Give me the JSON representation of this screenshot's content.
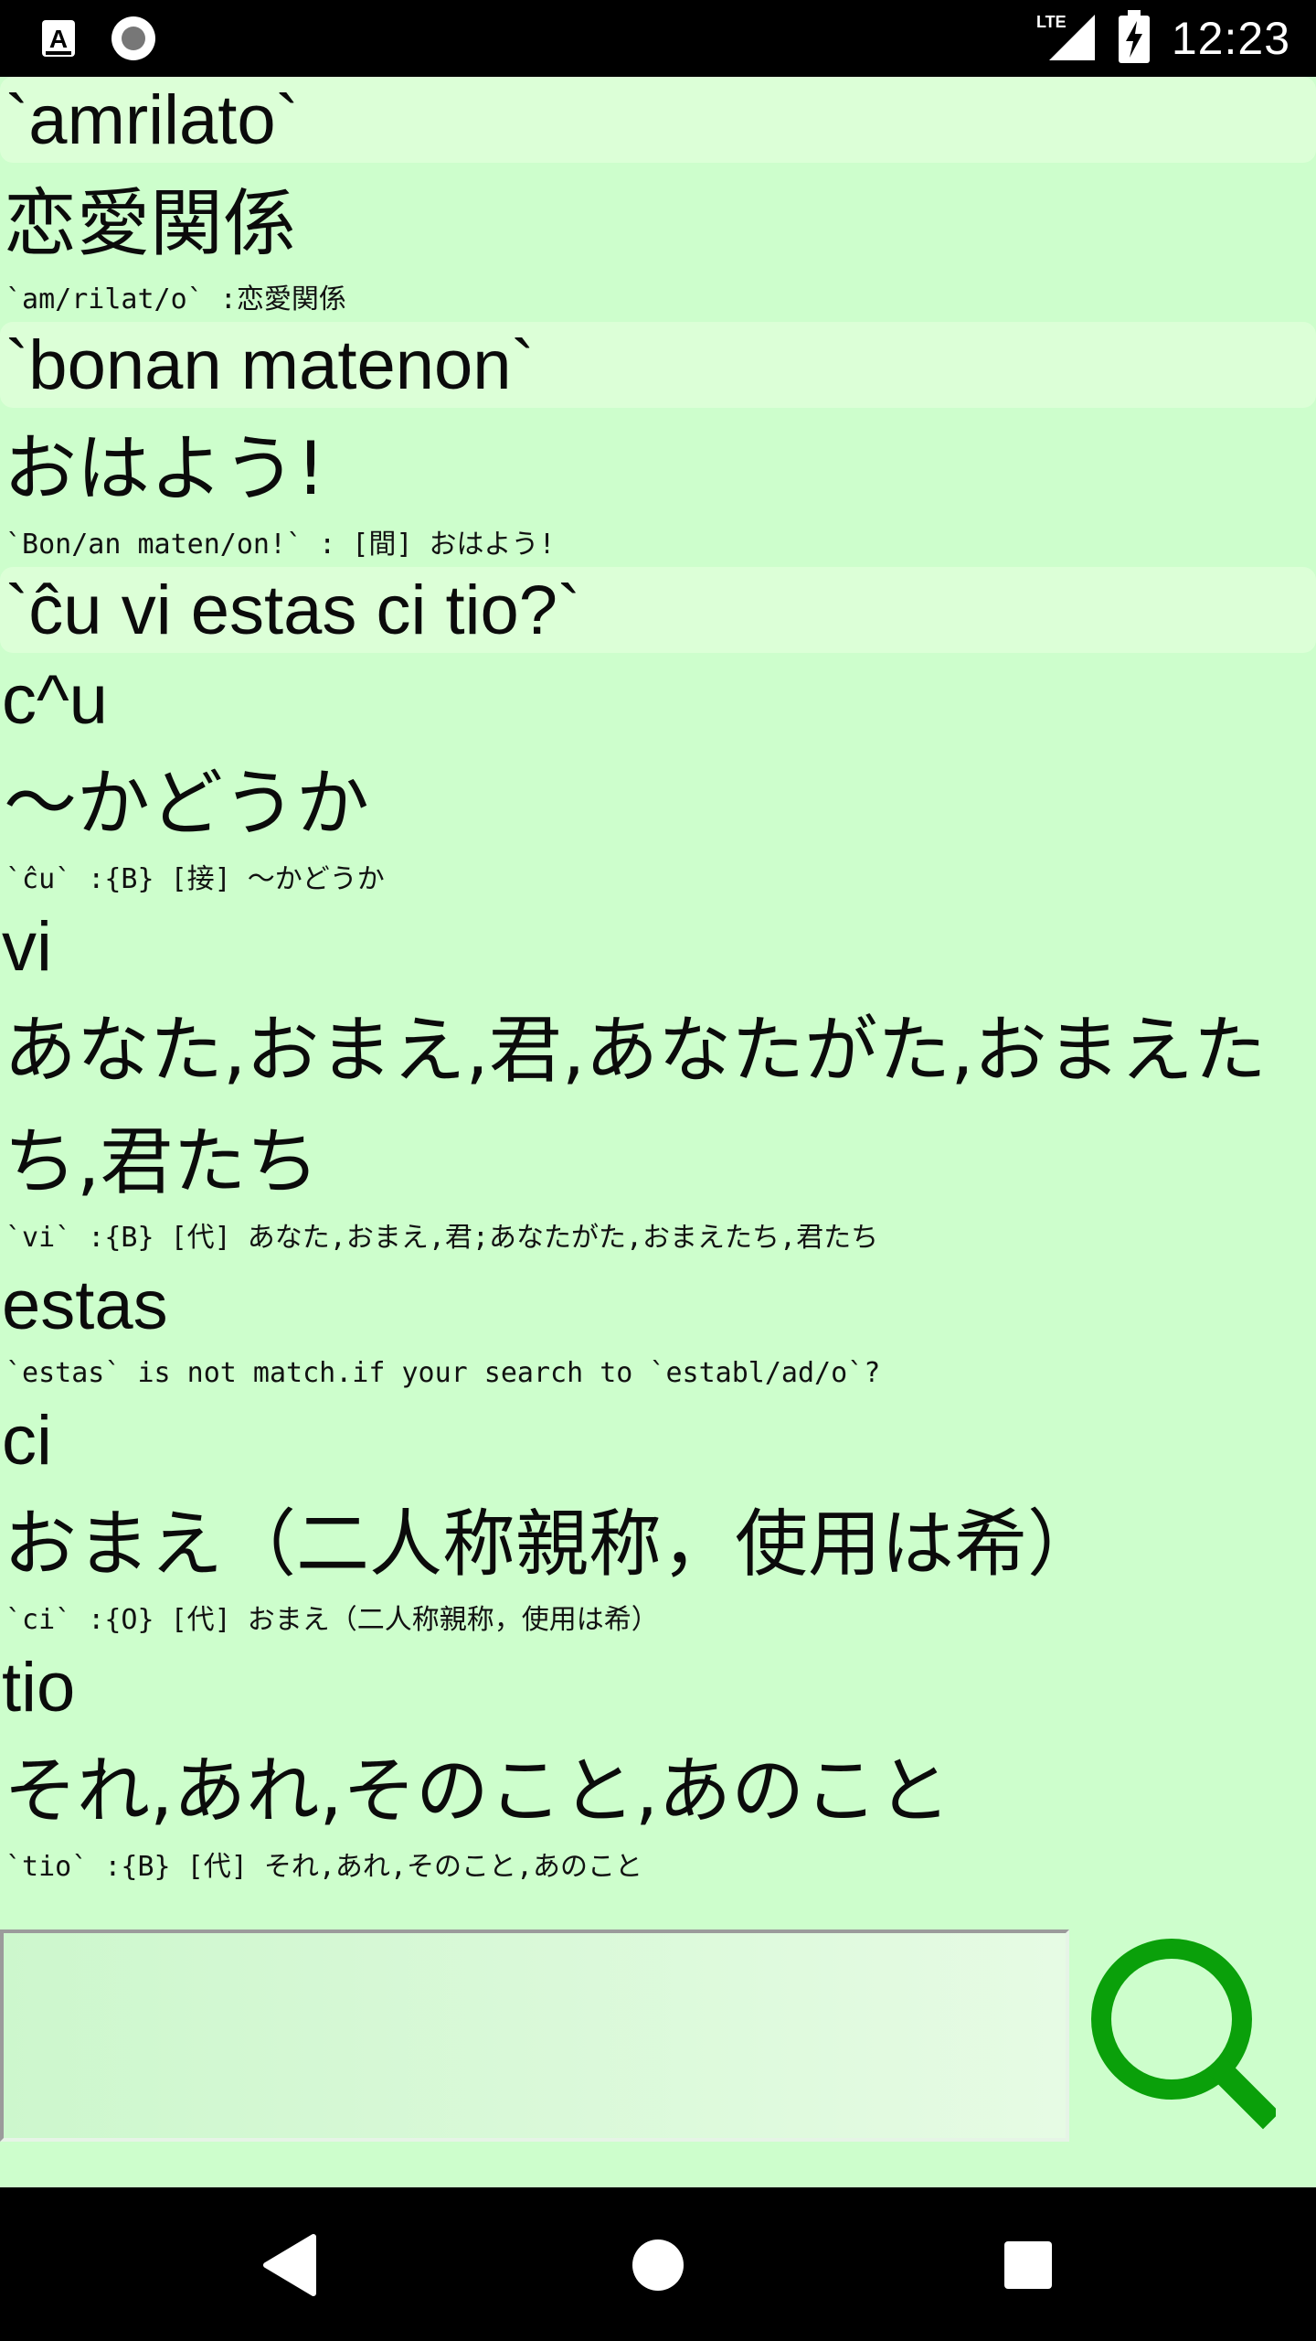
{
  "status_bar": {
    "time": "12:23",
    "network": "LTE",
    "notification_icons": [
      "app-a-icon",
      "circle-record-icon"
    ]
  },
  "entries": [
    {
      "query": "`amrilato`",
      "meaning": "恋愛関係",
      "detail": "`am/rilat/o` :恋愛関係"
    },
    {
      "query": "`bonan matenon`",
      "meaning": "おはよう!",
      "detail": "`Bon/an maten/on!` : [間] おはよう!"
    },
    {
      "query": "`ĉu vi estas ci tio?`",
      "words": [
        {
          "word": "c^u",
          "meaning": "～かどうか",
          "detail": "`ĉu` :{B} [接] ～かどうか"
        },
        {
          "word": "vi",
          "meaning": "あなた,おまえ,君,あなたがた,おまえたち,君たち",
          "detail": "`vi` :{B} [代] あなた,おまえ,君;あなたがた,おまえたち,君たち"
        },
        {
          "word": "estas",
          "detail": "`estas` is not match.if your search to `establ/ad/o`?"
        },
        {
          "word": "ci",
          "meaning": "おまえ（二人称親称，使用は希）",
          "detail": "`ci` :{O} [代] おまえ（二人称親称，使用は希）"
        },
        {
          "word": "tio",
          "meaning": "それ,あれ,そのこと,あのこと",
          "detail": "`tio` :{B} [代] それ,あれ,そのこと,あのこと"
        }
      ]
    }
  ],
  "search": {
    "value": "",
    "button_icon": "search-icon"
  },
  "colors": {
    "background": "#cdfecc",
    "query_row": "#dcffd7",
    "search_icon": "#0aa00a"
  },
  "nav_bar": {
    "buttons": [
      "back-icon",
      "home-icon",
      "recents-icon"
    ]
  }
}
